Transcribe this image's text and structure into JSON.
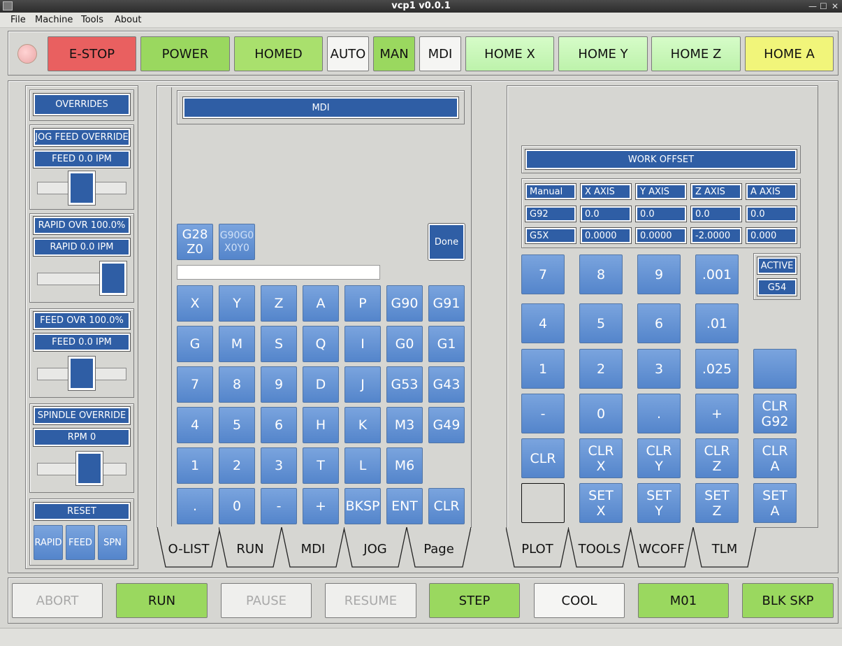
{
  "window": {
    "title": "vcp1 v0.0.1",
    "min": "—",
    "max": "☐",
    "close": "✕"
  },
  "menu": [
    "File",
    "Machine",
    "Tools",
    "About"
  ],
  "toolbar": {
    "estop": "E-STOP",
    "power": "POWER",
    "homed": "HOMED",
    "auto": "AUTO",
    "man": "MAN",
    "mdi": "MDI",
    "home_x": "HOME X",
    "home_y": "HOME Y",
    "home_z": "HOME Z",
    "home_a": "HOME A"
  },
  "overrides": {
    "title": "OVERRIDES",
    "jog_title": "JOG FEED OVERRIDE",
    "jog_feed": "FEED 0.0  IPM",
    "jog_level": 0.5,
    "rapid_title": "RAPID OVR 100.0%",
    "rapid_feed": "RAPID 0.0  IPM",
    "rapid_level": 1.0,
    "feed_title": "FEED OVR 100.0%",
    "feed_feed": "FEED 0.0  IPM",
    "feed_level": 0.5,
    "spindle_title": "SPINDLE OVERRIDE",
    "spindle_rpm": "RPM 0",
    "spindle_level": 0.62,
    "reset": "RESET",
    "rapid_btn": "RAPID",
    "feed_btn": "FEED",
    "spn_btn": "SPN"
  },
  "mdi": {
    "title": "MDI",
    "g28": "G28\nZ0",
    "g90": "G90G0\nX0Y0",
    "done": "Done",
    "input_value": "",
    "keys": [
      [
        "X",
        "Y",
        "Z",
        "A",
        "P",
        "G90",
        "G91"
      ],
      [
        "G",
        "M",
        "S",
        "Q",
        "I",
        "G0",
        "G1"
      ],
      [
        "7",
        "8",
        "9",
        "D",
        "J",
        "G53",
        "G43"
      ],
      [
        "4",
        "5",
        "6",
        "H",
        "K",
        "M3",
        "G49"
      ],
      [
        "1",
        "2",
        "3",
        "T",
        "L",
        "M6",
        ""
      ],
      [
        ".",
        "0",
        "-",
        "+",
        "BKSP",
        "ENT",
        "CLR"
      ]
    ]
  },
  "left_tabs": [
    "O-LIST",
    "RUN",
    "MDI",
    "JOG",
    "Page"
  ],
  "right_tabs": [
    "PLOT",
    "TOOLS",
    "WCOFF",
    "TLM"
  ],
  "work_offset": {
    "title": "WORK OFFSET",
    "header": [
      "Manual",
      "X AXIS",
      "Y AXIS",
      "Z AXIS",
      "A AXIS"
    ],
    "g92": [
      "G92",
      "0.0",
      "0.0",
      "0.0",
      "0.0"
    ],
    "g5x": [
      "G5X",
      "0.0000",
      "0.0000",
      "-2.0000",
      "0.000"
    ],
    "active_label": "ACTIVE",
    "active_value": "G54"
  },
  "keypad": [
    [
      "7",
      "8",
      "9",
      ".001"
    ],
    [
      "4",
      "5",
      "6",
      ".01"
    ],
    [
      "1",
      "2",
      "3",
      ".025",
      ""
    ],
    [
      "-",
      "0",
      ".",
      "+",
      "CLR\nG92"
    ],
    [
      "CLR",
      "CLR\nX",
      "CLR\nY",
      "CLR\nZ",
      "CLR\nA"
    ],
    [
      "",
      "SET\nX",
      "SET\nY",
      "SET\nZ",
      "SET\nA"
    ]
  ],
  "bottom": {
    "abort": "ABORT",
    "run": "RUN",
    "pause": "PAUSE",
    "resume": "RESUME",
    "step": "STEP",
    "cool": "COOL",
    "m01": "M01",
    "blk_skp": "BLK SKP"
  }
}
